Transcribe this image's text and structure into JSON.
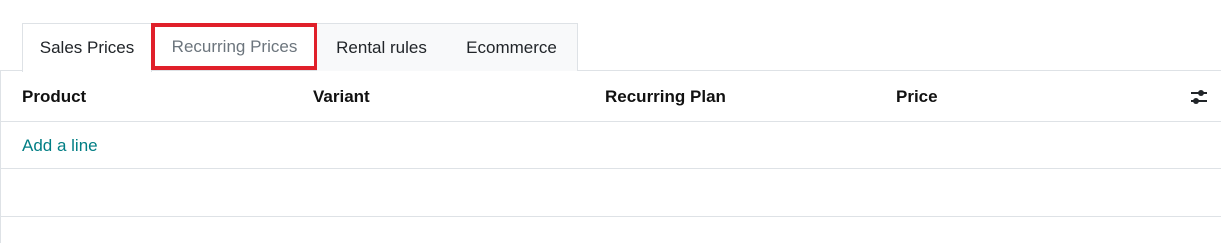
{
  "tabs": [
    {
      "label": "Sales Prices"
    },
    {
      "label": "Recurring Prices"
    },
    {
      "label": "Rental rules"
    },
    {
      "label": "Ecommerce"
    }
  ],
  "table": {
    "columns": [
      "Product",
      "Variant",
      "Recurring Plan",
      "Price"
    ],
    "add_line_label": "Add a line",
    "settings_icon": "sliders-icon"
  },
  "colors": {
    "highlight": "#e0202a",
    "link": "#017e84",
    "border": "#dee2e6"
  }
}
